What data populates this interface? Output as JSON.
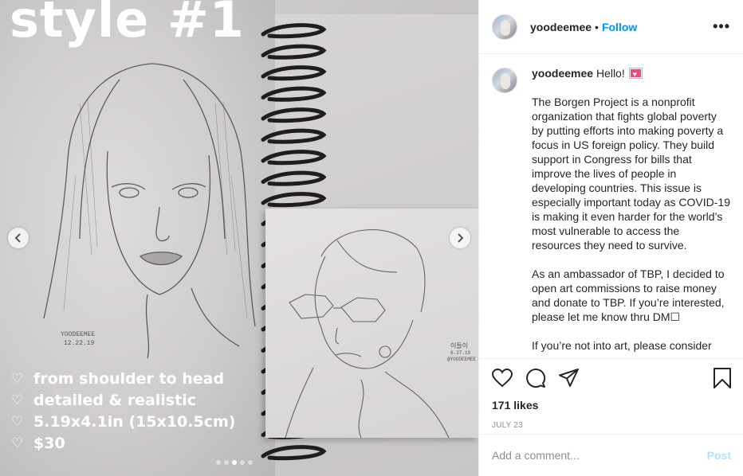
{
  "media": {
    "title_overlay": "style #1",
    "caption_lines": [
      "from shoulder to head",
      "detailed & realistic",
      "5.19x4.1in (15x10.5cm)",
      "$30"
    ],
    "heart_glyph": "♡",
    "sketch_signature_1": "YOODEEMEE",
    "sketch_date_1": "12.22.19",
    "sketch_signature_2": "이들이",
    "sketch_date_2": "6.27.19",
    "sketch_handle_2": "@YOODEEMEE",
    "carousel_dots": 5,
    "carousel_active_index": 2
  },
  "header": {
    "username": "yoodeemee",
    "bullet": "•",
    "follow_label": "Follow",
    "more_label": "•••"
  },
  "comment": {
    "username": "yoodeemee",
    "greeting": "Hello!",
    "paragraphs": [
      "The Borgen Project is a nonprofit organization that fights global poverty by putting efforts into making poverty a focus in US foreign policy. They build support in Congress for bills that improve the lives of people in developing countries. This issue is especially important today as COVID-19 is making it even harder for the world’s most vulnerable to access the resources they need to survive.",
      "As an ambassador of TBP, I decided to open art commissions to raise money and donate to TBP. If you’re interested, please let me know thru DM☐",
      "If you’re not into art, please consider"
    ]
  },
  "post": {
    "likes": "171 likes",
    "date": "JULY 23",
    "comment_placeholder": "Add a comment...",
    "post_label": "Post"
  },
  "colors": {
    "follow_blue": "#0095f6",
    "post_disabled_blue": "#b2dffc",
    "muted_gray": "#8e8e8e"
  }
}
